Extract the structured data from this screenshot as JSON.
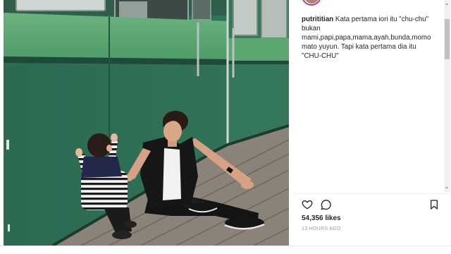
{
  "post": {
    "caption": {
      "username": "putrititian",
      "text": "Kata pertama iori itu \"chu-chu\" bukan mami,papi,papa,mama,ayah,bunda,momomato yuyun. Tapi kata pertama dia itu \"CHU-CHU\""
    },
    "likes_label": "54,356 likes",
    "timestamp": "13 HOURS AGO"
  },
  "icons": {
    "like": "heart-icon",
    "comment": "comment-icon",
    "save": "bookmark-icon",
    "scroll_up": "chevron-up-icon",
    "scroll_down": "chevron-down-icon"
  },
  "comments_scrollbar": {
    "scroll_fraction": 0.08,
    "visible_fraction": 0.23
  },
  "colors": {
    "text": "#262626",
    "muted": "#999999",
    "divider": "#efefef",
    "avatar_ring": "#d6356b"
  }
}
